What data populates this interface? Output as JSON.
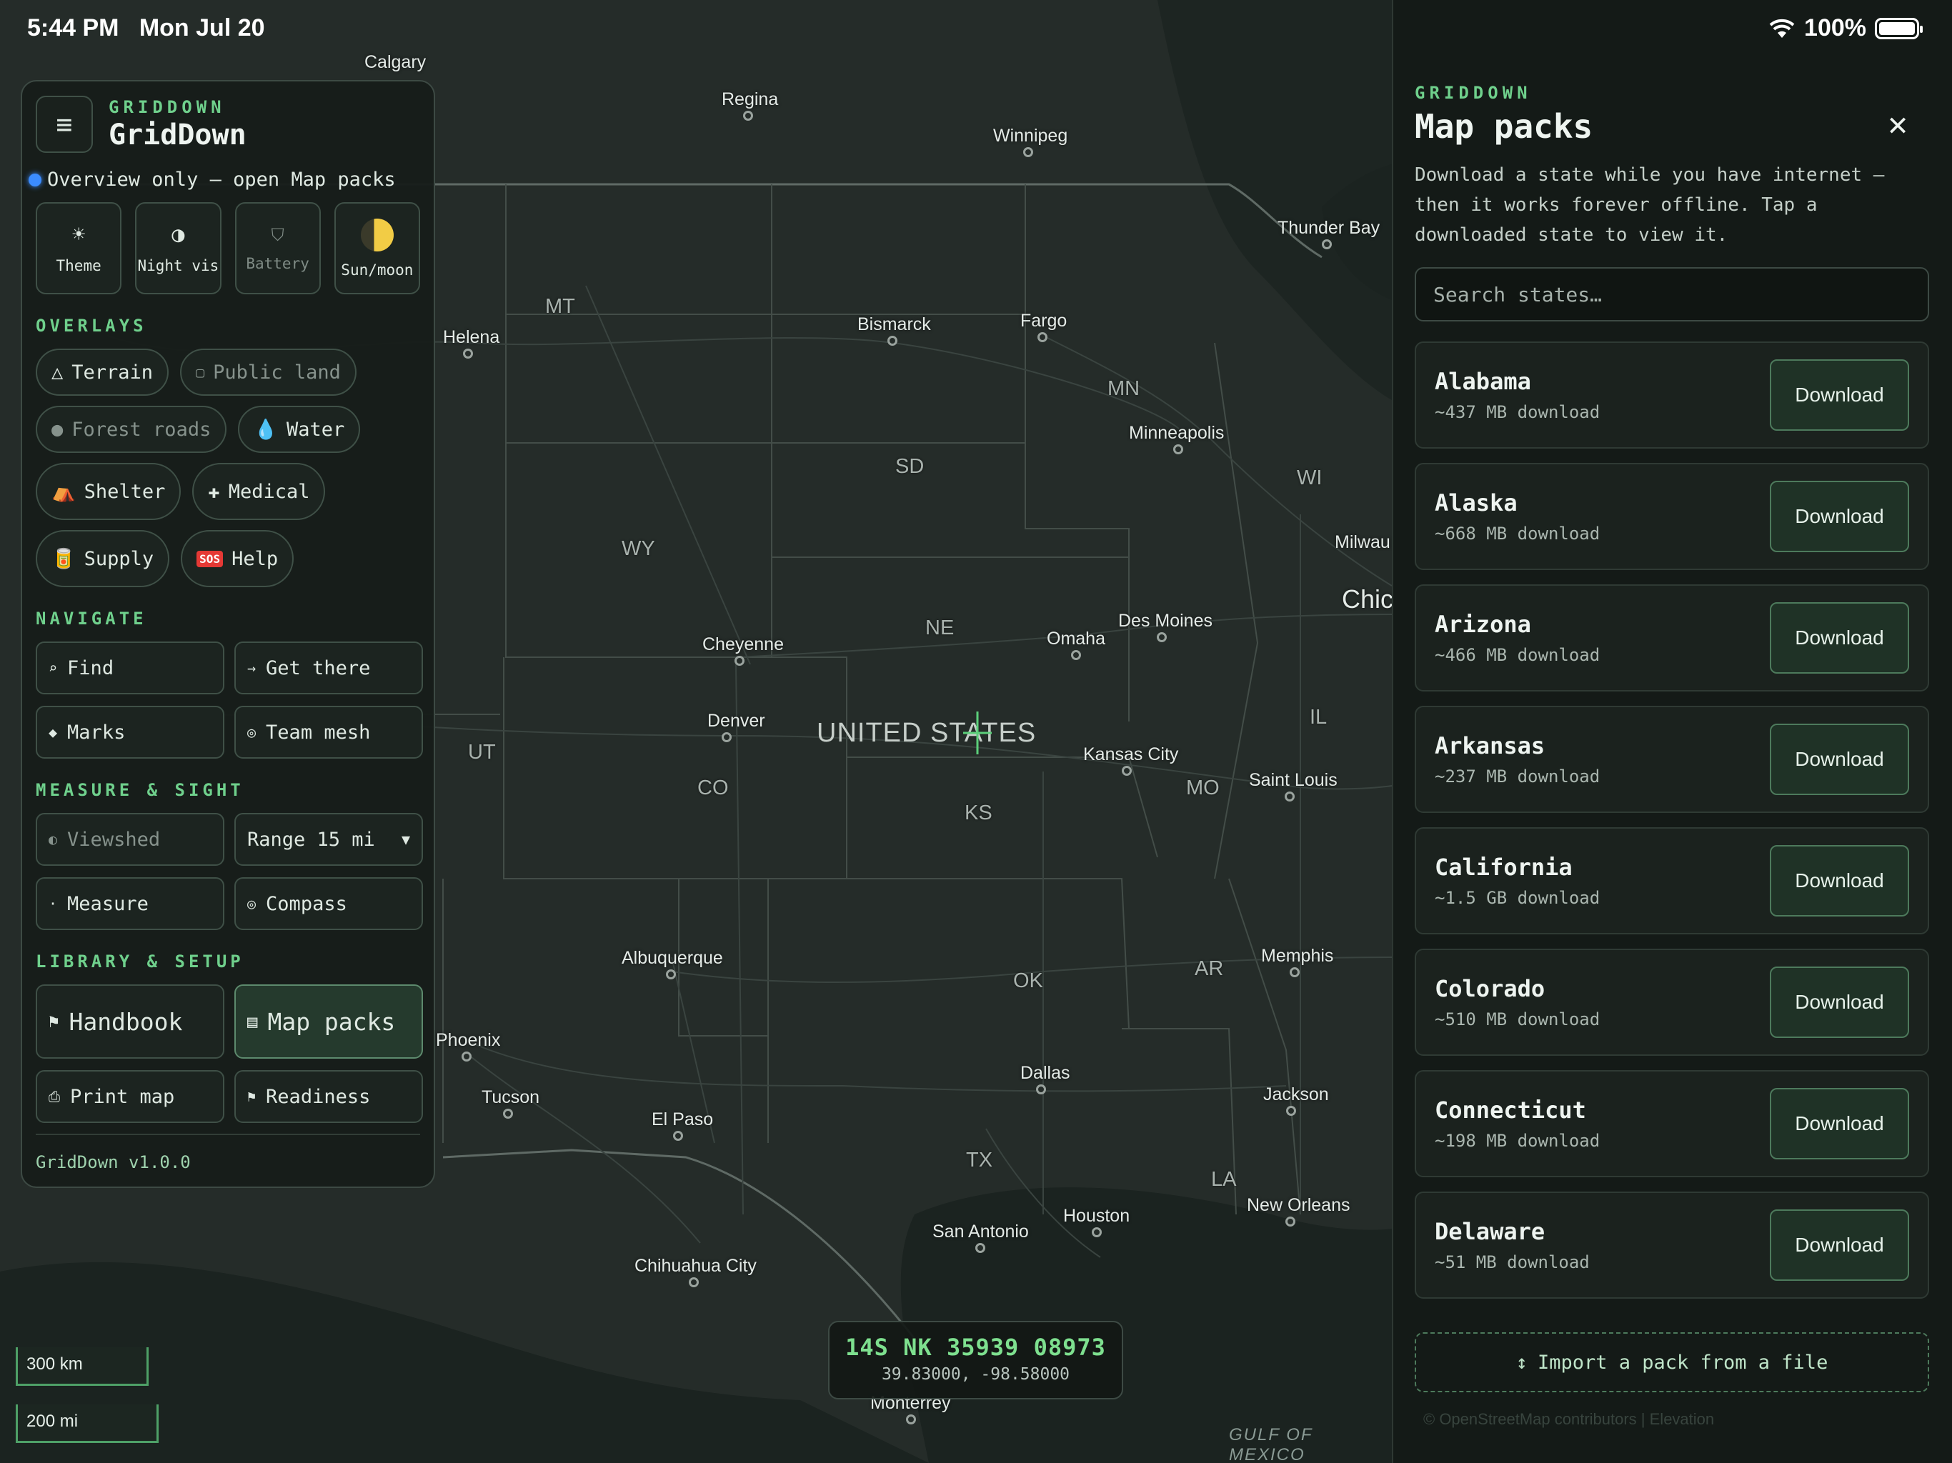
{
  "status": {
    "time": "5:44 PM",
    "date": "Mon Jul 20",
    "battery": "100%"
  },
  "map": {
    "cities": [
      {
        "name": "Calgary"
      },
      {
        "name": "Regina"
      },
      {
        "name": "Winnipeg"
      },
      {
        "name": "Thunder Bay"
      },
      {
        "name": "Helena"
      },
      {
        "name": "Bismarck"
      },
      {
        "name": "Fargo"
      },
      {
        "name": "Minneapolis"
      },
      {
        "name": "Milwau"
      },
      {
        "name": "Chic"
      },
      {
        "name": "Cheyenne"
      },
      {
        "name": "Omaha"
      },
      {
        "name": "Des Moines"
      },
      {
        "name": "Denver"
      },
      {
        "name": "Kansas City"
      },
      {
        "name": "Saint Louis"
      },
      {
        "name": "Albuquerque"
      },
      {
        "name": "Memphis"
      },
      {
        "name": "Phoenix"
      },
      {
        "name": "Dallas"
      },
      {
        "name": "Tucson"
      },
      {
        "name": "El Paso"
      },
      {
        "name": "Jackson"
      },
      {
        "name": "Houston"
      },
      {
        "name": "San Antonio"
      },
      {
        "name": "New Orleans"
      },
      {
        "name": "Chihuahua City"
      },
      {
        "name": "Monterrey"
      }
    ],
    "states": [
      "MT",
      "MN",
      "WI",
      "SD",
      "WY",
      "NE",
      "IL",
      "UT",
      "CO",
      "KS",
      "MO",
      "OK",
      "AR",
      "TX",
      "LA"
    ],
    "country": "UNITED STATES",
    "water": "GULF OF MEXICO",
    "scale_km": "300 km",
    "scale_mi": "200 mi",
    "coord": {
      "mgrs": "14S NK 35939 08973",
      "latlon": "39.83000, -98.58000"
    }
  },
  "left_panel": {
    "brand_small": "GRIDDOWN",
    "brand_big": "GridDown",
    "overview": "Overview only — open Map packs",
    "modes": [
      {
        "label": "Theme",
        "icon": "sun-icon"
      },
      {
        "label": "Night vis",
        "icon": "contrast-icon"
      },
      {
        "label": "Battery",
        "icon": "battery-save-icon"
      },
      {
        "label": "Sun/moon",
        "icon": "moon-icon"
      }
    ],
    "sections": {
      "overlays": "OVERLAYS",
      "navigate": "NAVIGATE",
      "measure": "MEASURE & SIGHT",
      "library": "LIBRARY & SETUP"
    },
    "overlays": {
      "terrain": "Terrain",
      "public_land": "Public land",
      "forest_roads": "Forest roads",
      "water": "Water",
      "shelter": "Shelter",
      "medical": "Medical",
      "supply": "Supply",
      "help": "Help"
    },
    "navigate": {
      "find": "Find",
      "get_there": "Get there",
      "marks": "Marks",
      "team_mesh": "Team mesh"
    },
    "measure": {
      "viewshed": "Viewshed",
      "range": "Range 15 mi",
      "measure": "Measure",
      "compass": "Compass"
    },
    "library": {
      "handbook": "Handbook",
      "map_packs": "Map packs",
      "print_map": "Print map",
      "readiness": "Readiness"
    },
    "version": "GridDown v1.0.0"
  },
  "right_panel": {
    "brand": "GRIDDOWN",
    "title": "Map packs",
    "description": "Download a state while you have internet — then it works forever offline. Tap a downloaded state to view it.",
    "search_placeholder": "Search states…",
    "states": [
      {
        "name": "Alabama",
        "size": "~437 MB download",
        "action": "Download"
      },
      {
        "name": "Alaska",
        "size": "~668 MB download",
        "action": "Download"
      },
      {
        "name": "Arizona",
        "size": "~466 MB download",
        "action": "Download"
      },
      {
        "name": "Arkansas",
        "size": "~237 MB download",
        "action": "Download"
      },
      {
        "name": "California",
        "size": "~1.5 GB download",
        "action": "Download"
      },
      {
        "name": "Colorado",
        "size": "~510 MB download",
        "action": "Download"
      },
      {
        "name": "Connecticut",
        "size": "~198 MB download",
        "action": "Download"
      },
      {
        "name": "Delaware",
        "size": "~51 MB download",
        "action": "Download"
      }
    ],
    "import_label": "Import a pack from a file",
    "attribution": "© OpenStreetMap contributors | Elevation"
  }
}
